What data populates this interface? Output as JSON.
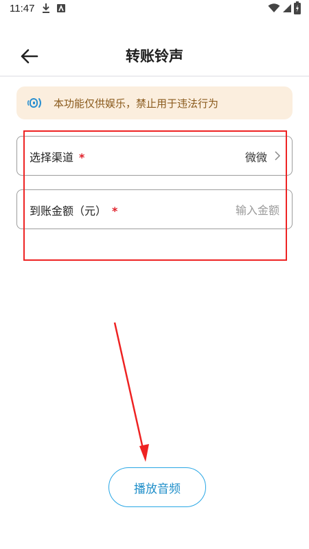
{
  "status_bar": {
    "time": "11:47"
  },
  "header": {
    "title": "转账铃声"
  },
  "notice": {
    "text": "本功能仅供娱乐，禁止用于违法行为"
  },
  "form": {
    "channel": {
      "label": "选择渠道",
      "required_mark": "*",
      "value": "微微"
    },
    "amount": {
      "label": "到账金额（元）",
      "required_mark": "*",
      "placeholder": "输入金额",
      "value": ""
    }
  },
  "actions": {
    "play_label": "播放音频"
  },
  "colors": {
    "accent": "#27a6e5",
    "notice_bg": "#fbeede",
    "notice_text": "#8a5a1c",
    "required": "#e0202a",
    "annotation": "#ee2222"
  }
}
